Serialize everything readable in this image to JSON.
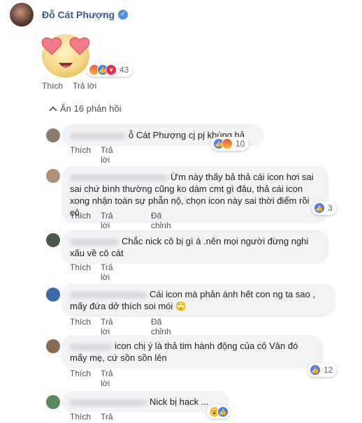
{
  "post_author": {
    "name": "Đỗ Cát Phượng",
    "verified_icon": "verified-check-icon"
  },
  "sticker": {
    "icon": "heart-eyes-emoji"
  },
  "main_comment": {
    "reactions": [
      "angry",
      "like",
      "love"
    ],
    "reaction_count": "43",
    "like_label": "Thích",
    "reply_label": "Trả lời"
  },
  "replies_toggle": {
    "label": "Ẩn 16 phản hồi"
  },
  "replies": [
    {
      "text": "ỗ Cát Phượng cj pj khùng hả",
      "like_label": "Thích",
      "reply_label": "Trả lời",
      "reactions": [
        "like",
        "angry"
      ],
      "reaction_count": "10"
    },
    {
      "text": "Ừm này thấy bả thả cái icon hơi sai sai chứ bình thường cũng ko dám cmt gì đâu, thả cái icon xong nhận toàn sự phẫn nộ, chọn icon này sai thời điểm rồi cô.",
      "like_label": "Thích",
      "reply_label": "Trả lời",
      "edit_label": "Đã chỉnh sửa",
      "reactions": [
        "like"
      ],
      "reaction_count": "3"
    },
    {
      "text": "Chắc nick cô bị gì á .nên mọi người đừng nghi xấu về cô cát",
      "like_label": "Thích",
      "reply_label": "Trả lời"
    },
    {
      "text": "Cái icon mà phản ánh hết con ng ta sao , mấy đứa dở thích soi mói 🙄",
      "like_label": "Thích",
      "reply_label": "Trả lời",
      "edit_label": "Đã chỉnh sửa"
    },
    {
      "text": "icon chị ý là thả tim hành động của cô Vân đó mấy mẹ, cứ sồn sồn lên",
      "like_label": "Thích",
      "reply_label": "Trả lời",
      "reactions": [
        "like"
      ],
      "reaction_count": "12"
    },
    {
      "text": "Nick bị hack ...",
      "like_label": "Thích",
      "reply_label": "Trả lời",
      "reactions": [
        "wow",
        "like"
      ]
    }
  ]
}
